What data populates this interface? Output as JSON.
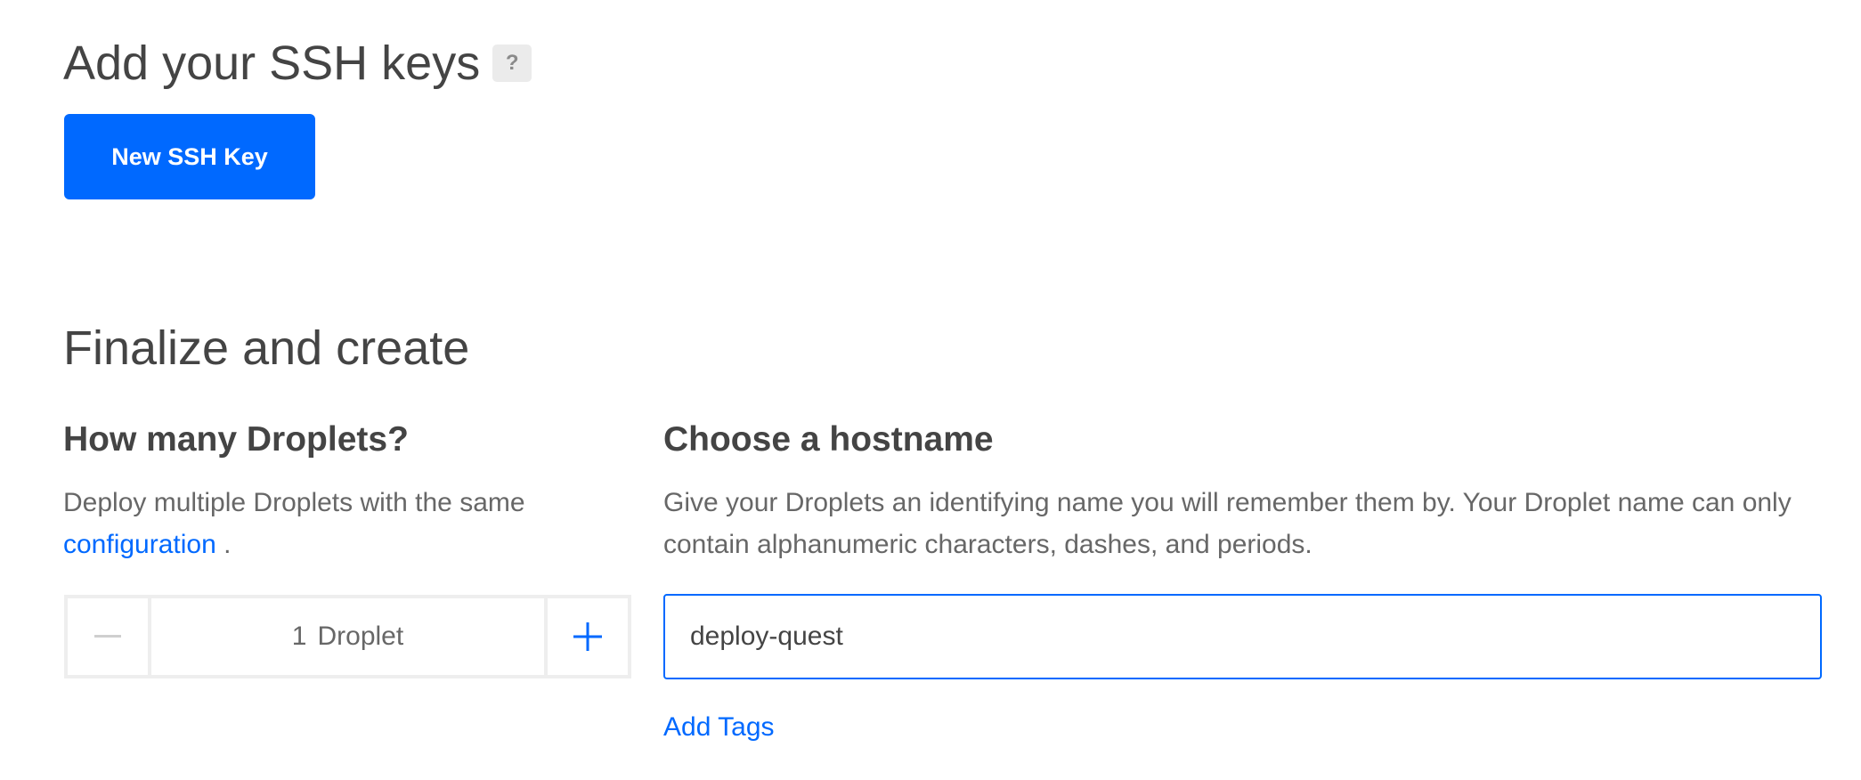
{
  "ssh_keys": {
    "title": "Add your SSH keys",
    "help_label": "?",
    "new_key_button": "New SSH Key"
  },
  "finalize": {
    "title": "Finalize and create",
    "droplets": {
      "heading": "How many Droplets?",
      "description": "Deploy multiple Droplets with the same",
      "link": "configuration",
      "suffix": " .",
      "minus_icon": "minus-icon",
      "plus_icon": "plus-icon",
      "count": "1",
      "unit": "Droplet"
    },
    "hostname": {
      "heading": "Choose a hostname",
      "description": "Give your Droplets an identifying name you will remember them by. Your Droplet name can only contain alphanumeric characters, dashes, and periods.",
      "value": "deploy-quest",
      "add_tags": "Add Tags"
    }
  },
  "colors": {
    "accent": "#0069ff",
    "text": "#444444",
    "muted_text": "#676767",
    "border": "#eeeeee"
  }
}
